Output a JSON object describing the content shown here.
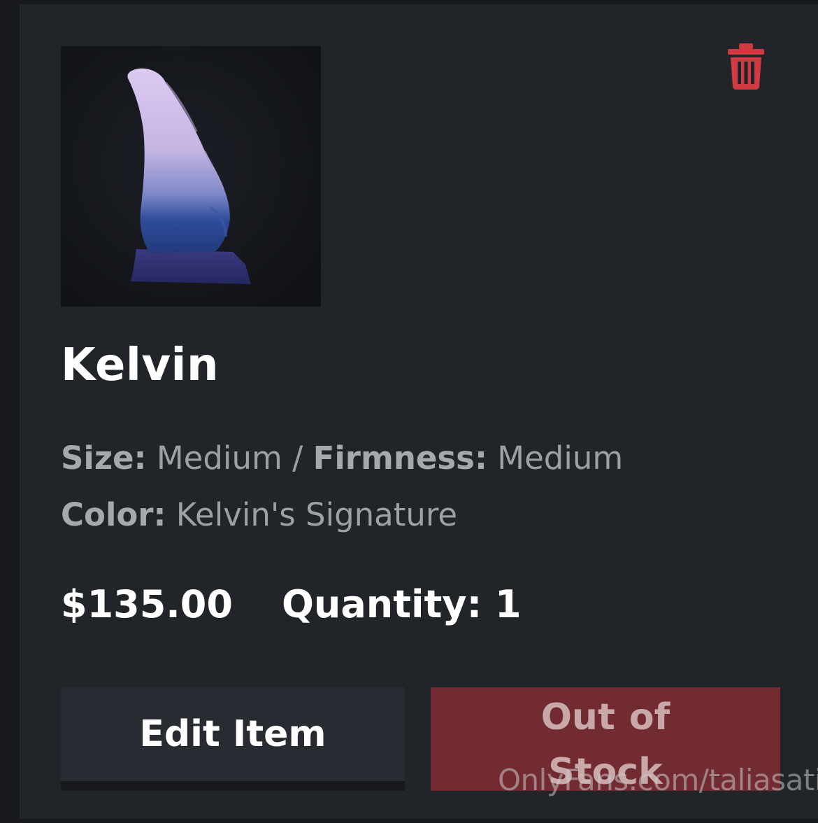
{
  "product": {
    "name": "Kelvin",
    "image_alt": "Kelvin product photo",
    "specs": {
      "size_label": "Size:",
      "size_value": "Medium",
      "separator": "/",
      "firmness_label": "Firmness:",
      "firmness_value": "Medium",
      "color_label": "Color:",
      "color_value": "Kelvin's Signature"
    },
    "price": "$135.00",
    "quantity_text": "Quantity: 1"
  },
  "actions": {
    "edit_label": "Edit Item",
    "stock_label": "Out of Stock",
    "delete_icon": "trash-icon"
  },
  "watermark": "OnlyFans.com/taliasati",
  "colors": {
    "background": "#16181b",
    "card": "#212429",
    "accent_red": "#d13a40",
    "out_of_stock": "#722b30"
  }
}
